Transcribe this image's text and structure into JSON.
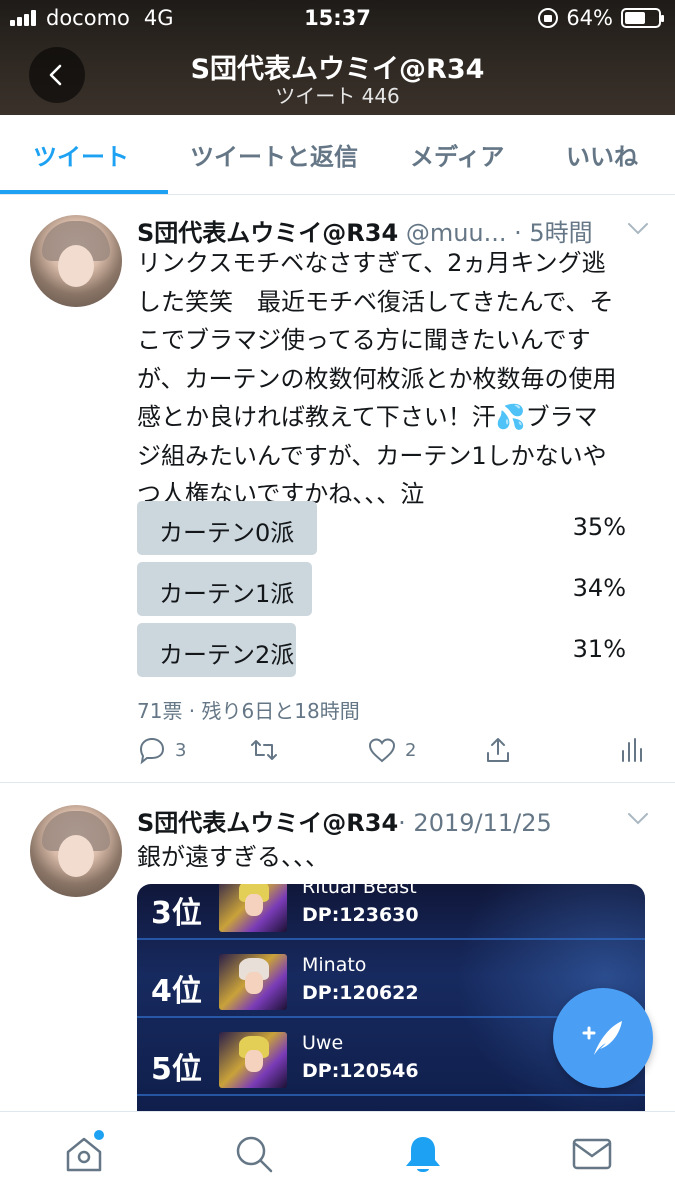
{
  "status_bar": {
    "carrier": "docomo",
    "network": "4G",
    "time": "15:37",
    "battery": "64%",
    "battery_level": 0.64
  },
  "header": {
    "title": "S団代表ムウミイ@R34",
    "subtitle": "ツイート 446"
  },
  "tabs": [
    {
      "label": "ツイート",
      "active": true
    },
    {
      "label": "ツイートと返信",
      "active": false
    },
    {
      "label": "メディア",
      "active": false
    },
    {
      "label": "いいね",
      "active": false
    }
  ],
  "tweets": [
    {
      "name": "S団代表ムウミイ@R34",
      "handle": "@muu...",
      "time": "· 5時間",
      "lines": [
        "リンクスモチベなさすぎて、2ヵ月キング逃",
        "した笑笑　最近モチベ復活してきたんで、そ",
        "こでブラマジ使ってる方に聞きたいんです",
        "が、カーテンの枚数何枚派とか枚数毎の使用",
        "感とか良ければ教えて下さい！汗💦ブラマ",
        "ジ組みたいんですが、カーテン1しかないや",
        "つ人権ないですかね、、、泣"
      ],
      "poll": {
        "options": [
          {
            "label": "カーテン0派",
            "percent": "35%",
            "value": 35
          },
          {
            "label": "カーテン1派",
            "percent": "34%",
            "value": 34
          },
          {
            "label": "カーテン2派",
            "percent": "31%",
            "value": 31
          }
        ],
        "meta": "71票 · 残り6日と18時間"
      },
      "actions": {
        "replies": "3",
        "retweets": "",
        "likes": "2"
      }
    },
    {
      "name": "S団代表ムウミイ@R34",
      "handle": "",
      "time": "· 2019/11/25",
      "lines": [
        "銀が遠すぎる、、、"
      ],
      "ranking": [
        {
          "rank": "3位",
          "name": "Ritual Beast",
          "dp": "DP:123630"
        },
        {
          "rank": "4位",
          "name": "Minato",
          "dp": "DP:120622"
        },
        {
          "rank": "5位",
          "name": "Uwe",
          "dp": "DP:120546"
        }
      ]
    }
  ],
  "icons": {
    "back": "chevron-left-icon",
    "reply": "reply-icon",
    "retweet": "retweet-icon",
    "like": "heart-icon",
    "share": "share-icon",
    "analytics": "analytics-icon",
    "compose": "compose-tweet-icon",
    "nav": [
      "home-icon",
      "search-icon",
      "notifications-icon",
      "messages-icon"
    ]
  },
  "colors": {
    "accent": "#1da1f2",
    "secondary_text": "#657786",
    "poll_fill": "#ccd6dd",
    "fab": "#4a9ff5"
  }
}
